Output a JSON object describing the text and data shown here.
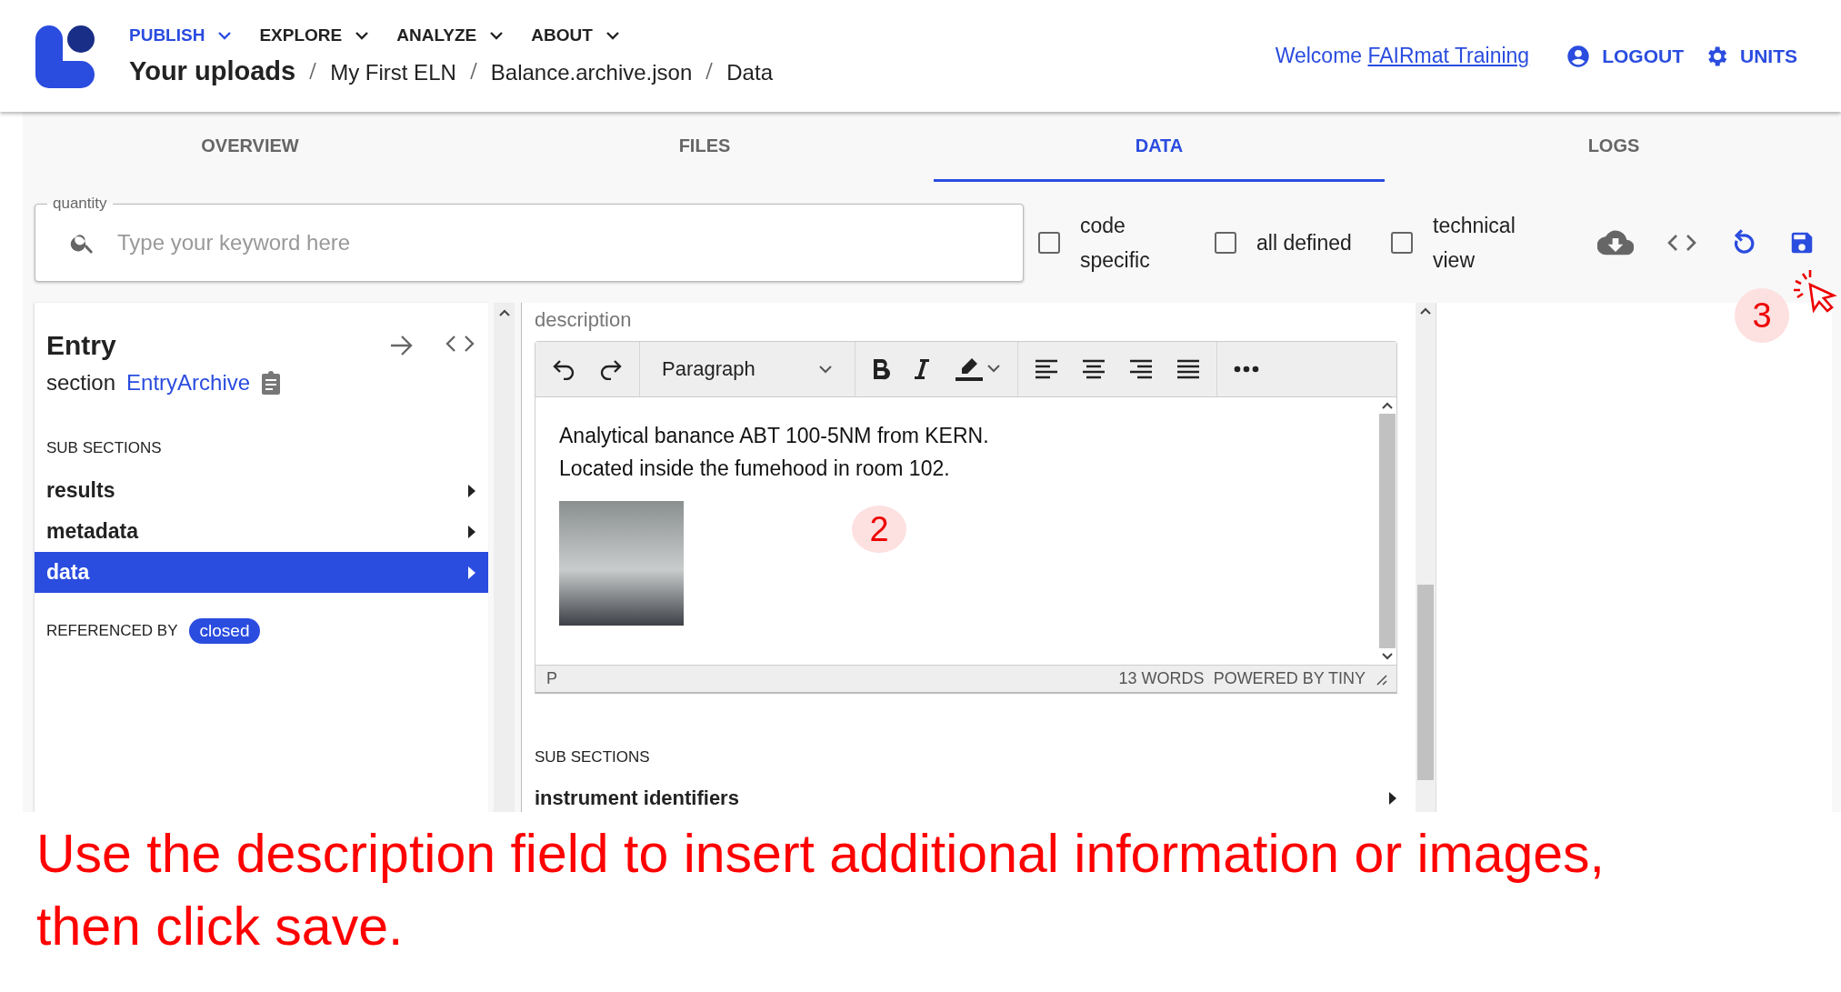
{
  "nav": {
    "menus": [
      {
        "label": "PUBLISH",
        "selected": true
      },
      {
        "label": "EXPLORE",
        "selected": false
      },
      {
        "label": "ANALYZE",
        "selected": false
      },
      {
        "label": "ABOUT",
        "selected": false
      }
    ],
    "breadcrumbs": [
      "Your uploads",
      "My First ELN",
      "Balance.archive.json",
      "Data"
    ],
    "welcome": "Welcome",
    "user": "FAIRmat Training",
    "logout": "LOGOUT",
    "units": "UNITS"
  },
  "tabs": [
    {
      "label": "OVERVIEW",
      "selected": false
    },
    {
      "label": "FILES",
      "selected": false
    },
    {
      "label": "DATA",
      "selected": true
    },
    {
      "label": "LOGS",
      "selected": false
    }
  ],
  "search": {
    "label": "quantity",
    "placeholder": "Type your keyword here"
  },
  "filters": [
    {
      "label": "code specific",
      "checked": false
    },
    {
      "label": "all defined",
      "checked": false
    },
    {
      "label": "technical view",
      "checked": false
    }
  ],
  "save_marker": "3",
  "entry": {
    "title": "Entry",
    "section_label": "section",
    "section_link": "EntryArchive",
    "sub_sections_heading": "SUB SECTIONS",
    "items": [
      {
        "label": "results",
        "selected": false
      },
      {
        "label": "metadata",
        "selected": false
      },
      {
        "label": "data",
        "selected": true
      }
    ],
    "referenced_by": "REFERENCED BY",
    "reference_badge": "closed"
  },
  "editor": {
    "field_label": "description",
    "format": "Paragraph",
    "lines": [
      "Analytical banance ABT 100-5NM from KERN.",
      "Located inside the fumehood in room 102."
    ],
    "marker": "2",
    "path": "P",
    "word_count": "13 WORDS",
    "branding": "POWERED BY TINY",
    "sub_sections_heading": "SUB SECTIONS",
    "sub_sections": [
      "instrument identifiers"
    ]
  },
  "caption": "Use the description field to insert additional information or images, then click save."
}
